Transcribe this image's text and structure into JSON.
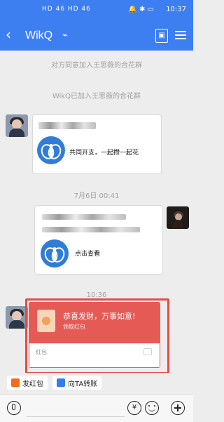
{
  "status": {
    "left": "HD 46 HD 46",
    "right": "10:37"
  },
  "nav": {
    "title": "WikQ"
  },
  "system_messages": [
    "对方同意加入王思薇的合花群",
    "WikQ已加入王思薇的合花群",
    "7月6日 00:41",
    "10:36"
  ],
  "cards": [
    {
      "text": "共同开支，一起攒一起花"
    },
    {
      "text": "点击查看"
    }
  ],
  "red_packet": {
    "title": "恭喜发财，万事如意!",
    "subtitle": "领取红包",
    "label": "红包"
  },
  "actions": {
    "send_red_packet": "发红包",
    "transfer": "向TA转账"
  },
  "icons": {
    "yuan": "¥"
  }
}
